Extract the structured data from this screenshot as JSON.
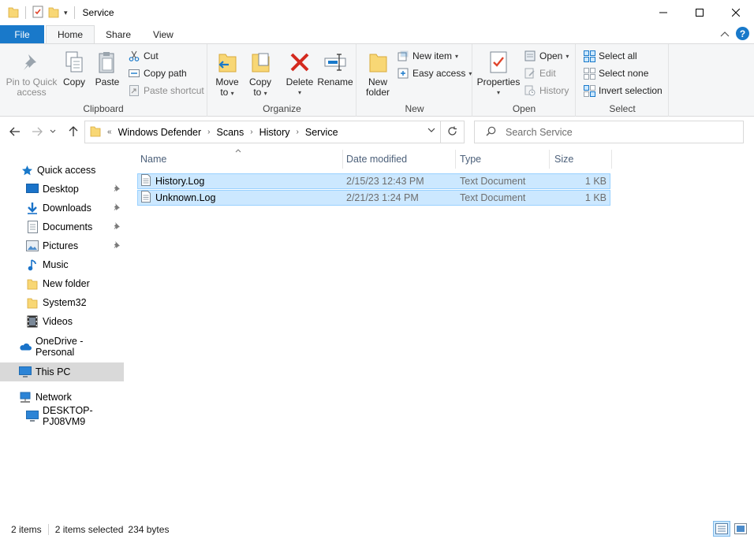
{
  "window": {
    "title": "Service",
    "controls": {
      "minimize": "—",
      "maximize": "☐",
      "close": "✕"
    }
  },
  "ribbon_tabs": [
    {
      "label": "File"
    },
    {
      "label": "Home"
    },
    {
      "label": "Share"
    },
    {
      "label": "View"
    }
  ],
  "ribbon": {
    "clipboard": {
      "label": "Clipboard",
      "pin_label_1": "Pin to Quick",
      "pin_label_2": "access",
      "copy": "Copy",
      "paste": "Paste",
      "cut": "Cut",
      "copy_path": "Copy path",
      "paste_shortcut": "Paste shortcut"
    },
    "organize": {
      "label": "Organize",
      "move_1": "Move",
      "move_2": "to",
      "copy_1": "Copy",
      "copy_2": "to",
      "delete": "Delete",
      "rename": "Rename"
    },
    "new": {
      "label": "New",
      "new_folder_1": "New",
      "new_folder_2": "folder",
      "new_item": "New item",
      "easy_access": "Easy access"
    },
    "open": {
      "label": "Open",
      "properties": "Properties",
      "open": "Open",
      "edit": "Edit",
      "history": "History"
    },
    "select": {
      "label": "Select",
      "select_all": "Select all",
      "select_none": "Select none",
      "invert_selection": "Invert selection"
    }
  },
  "address": {
    "overflow": "«",
    "crumbs": [
      "Windows Defender",
      "Scans",
      "History",
      "Service"
    ],
    "separator": "›",
    "search_placeholder": "Search Service"
  },
  "nav_pane": {
    "quick_access": "Quick access",
    "items": [
      {
        "label": "Desktop",
        "pinned": true
      },
      {
        "label": "Downloads",
        "pinned": true
      },
      {
        "label": "Documents",
        "pinned": true
      },
      {
        "label": "Pictures",
        "pinned": true
      },
      {
        "label": "Music",
        "pinned": false
      },
      {
        "label": "New folder",
        "pinned": false
      },
      {
        "label": "System32",
        "pinned": false
      },
      {
        "label": "Videos",
        "pinned": false
      }
    ],
    "onedrive": "OneDrive - Personal",
    "this_pc": "This PC",
    "network": "Network",
    "computer": "DESKTOP-PJ08VM9"
  },
  "columns": {
    "name": "Name",
    "date": "Date modified",
    "type": "Type",
    "size": "Size"
  },
  "files": [
    {
      "name": "History.Log",
      "date": "2/15/23 12:43 PM",
      "type": "Text Document",
      "size": "1 KB",
      "selected": true
    },
    {
      "name": "Unknown.Log",
      "date": "2/21/23 1:24 PM",
      "type": "Text Document",
      "size": "1 KB",
      "selected": true
    }
  ],
  "status": {
    "count": "2 items",
    "selected": "2 items selected",
    "bytes": "234 bytes"
  },
  "colors": {
    "accent": "#1979ca",
    "selection_bg": "#cce8ff",
    "selection_border": "#99d1ff",
    "folder": "#f8d775"
  }
}
